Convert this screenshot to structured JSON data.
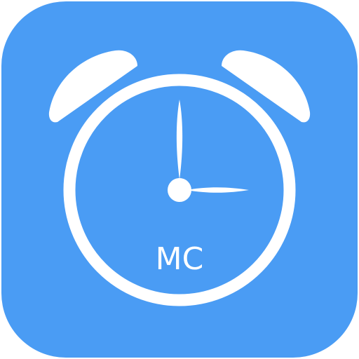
{
  "app_icon": {
    "label": "MC",
    "colors": {
      "background": "#4A9CF4",
      "foreground": "#FFFFFF"
    },
    "icon_name": "alarm-clock-icon"
  }
}
